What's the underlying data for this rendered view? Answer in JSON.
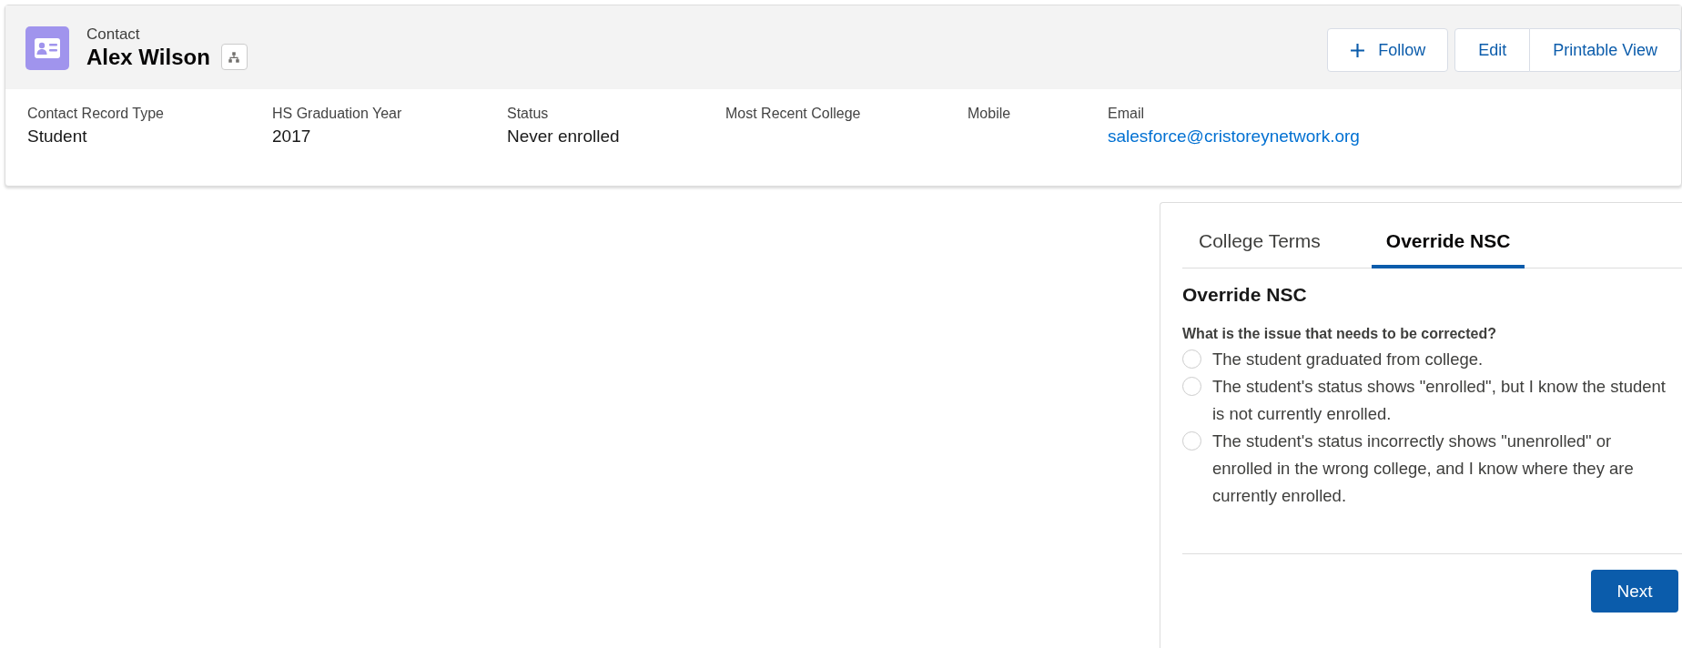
{
  "record": {
    "object_label": "Contact",
    "name": "Alex Wilson"
  },
  "actions": {
    "follow": "Follow",
    "group": [
      "Edit",
      "Printable View"
    ]
  },
  "fields": [
    {
      "label": "Contact Record Type",
      "value": "Student",
      "kind": "text"
    },
    {
      "label": "HS Graduation Year",
      "value": "2017",
      "kind": "text"
    },
    {
      "label": "Status",
      "value": "Never enrolled",
      "kind": "text"
    },
    {
      "label": "Most Recent College",
      "kind": "text"
    },
    {
      "label": "Mobile",
      "kind": "text"
    },
    {
      "label": "Email",
      "value": "salesforce@cristoreynetwork.org",
      "kind": "link"
    }
  ],
  "tabs": [
    {
      "label": "College Terms",
      "selected": false
    },
    {
      "label": "Override NSC",
      "selected": true
    }
  ],
  "form": {
    "heading": "Override NSC",
    "question": "What is the issue that needs to be corrected?",
    "options": [
      {
        "label": "The student graduated from college.",
        "selected": false
      },
      {
        "label": "The student's status shows \"enrolled\", but I know the student is not currently enrolled.",
        "selected": false
      },
      {
        "label": "The student's status incorrectly shows \"unenrolled\" or enrolled in the wrong college, and I know where they are currently enrolled.",
        "selected": false
      }
    ],
    "next_button": "Next"
  }
}
